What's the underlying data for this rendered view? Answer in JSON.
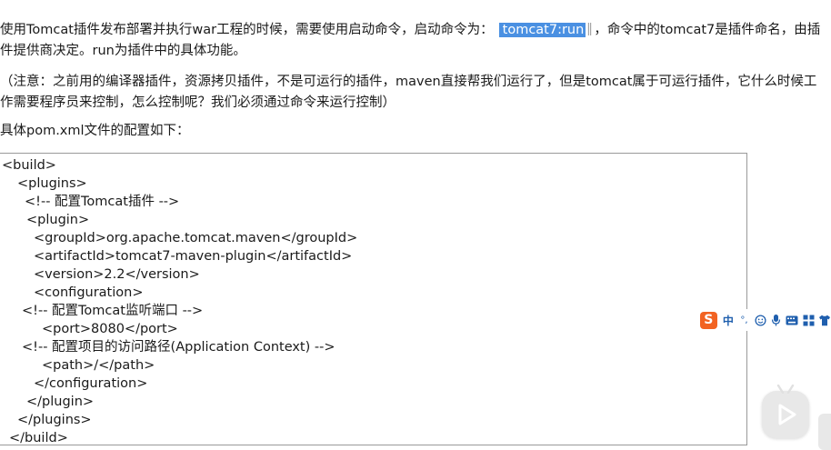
{
  "intro": {
    "before": "使用Tomcat插件发布部署并执行war工程的时候，需要使用启动命令，启动命令为：",
    "highlight": "tomcat7:run",
    "after": "，命令中的tomcat7是插件命名，由插件提供商决定。run为插件中的具体功能。"
  },
  "note": "（注意：之前用的编译器插件，资源拷贝插件，不是可运行的插件，maven直接帮我们运行了，但是tomcat属于可运行插件，它什么时候工作需要程序员来控制，怎么控制呢？我们必须通过命令来运行控制）",
  "config_heading": "具体pom.xml文件的配置如下：",
  "code_lines": [
    "<build>",
    "<plugins>",
    "<!-- 配置Tomcat插件 -->",
    "<plugin>",
    "<groupId>org.apache.tomcat.maven</groupId>",
    "<artifactId>tomcat7-maven-plugin</artifactId>",
    "<version>2.2</version>",
    "<configuration>",
    "<!-- 配置Tomcat监听端口 -->",
    "<port>8080</port>",
    "<!-- 配置项目的访问路径(Application Context) -->",
    "<path>/</path>",
    "</configuration>",
    "</plugin>",
    "</plugins>",
    "</build>"
  ],
  "ime_toolbar": {
    "logo": "S",
    "mode": "中",
    "punct": "°,",
    "icons": [
      "emoji-icon",
      "mic-icon",
      "keyboard-icon",
      "grid-icon",
      "shirt-icon"
    ]
  },
  "colors": {
    "highlight_bg": "#4a90e2",
    "ime_logo": "#f26322",
    "ime_icon": "#1f5fae"
  }
}
